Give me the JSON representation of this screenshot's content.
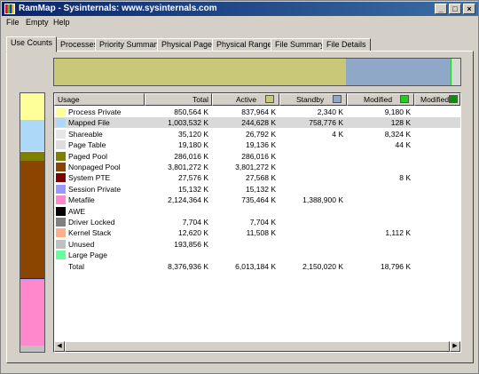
{
  "window": {
    "title": "RamMap - Sysinternals: www.sysinternals.com"
  },
  "window_buttons": {
    "minimize": "_",
    "maximize": "□",
    "close": "×"
  },
  "menu": [
    "File",
    "Empty",
    "Help"
  ],
  "tabs": [
    "Use Counts",
    "Processes",
    "Priority Summary",
    "Physical Pages",
    "Physical Ranges",
    "File Summary",
    "File Details"
  ],
  "active_tab": "Use Counts",
  "colors": {
    "process_private": "#ffff99",
    "mapped_file": "#add8f8",
    "shareable": "#e6e6e6",
    "page_table": "#dddddd",
    "paged_pool": "#808000",
    "nonpaged_pool": "#8b4500",
    "system_pte": "#800000",
    "session_private": "#9999ff",
    "metafile": "#ff88cc",
    "awe": "#000000",
    "driver_locked": "#808080",
    "kernel_stack": "#ffb08a",
    "unused": "#c0c0c0",
    "large_page": "#66ff99",
    "active": "#c8c878",
    "standby": "#8fa8c8",
    "modified": "#22cc22",
    "modified_nw": "#118811"
  },
  "table": {
    "columns": [
      "Usage",
      "Total",
      "Active",
      "Standby",
      "Modified",
      "Modified ..."
    ],
    "rows": [
      {
        "usage": "Process Private",
        "color": "#ffff99",
        "total": "850,564 K",
        "active": "837,964 K",
        "standby": "2,340 K",
        "modified": "9,180 K"
      },
      {
        "usage": "Mapped File",
        "color": "#add8f8",
        "total": "1,003,532 K",
        "active": "244,628 K",
        "standby": "758,776 K",
        "modified": "128 K",
        "selected": true
      },
      {
        "usage": "Shareable",
        "color": "#e6e6e6",
        "total": "35,120 K",
        "active": "26,792 K",
        "standby": "4 K",
        "modified": "8,324 K"
      },
      {
        "usage": "Page Table",
        "color": "#dddddd",
        "total": "19,180 K",
        "active": "19,136 K",
        "standby": "",
        "modified": "44 K"
      },
      {
        "usage": "Paged Pool",
        "color": "#808000",
        "total": "286,016 K",
        "active": "286,016 K",
        "standby": "",
        "modified": ""
      },
      {
        "usage": "Nonpaged Pool",
        "color": "#8b4500",
        "total": "3,801,272 K",
        "active": "3,801,272 K",
        "standby": "",
        "modified": ""
      },
      {
        "usage": "System PTE",
        "color": "#800000",
        "total": "27,576 K",
        "active": "27,568 K",
        "standby": "",
        "modified": "8 K"
      },
      {
        "usage": "Session Private",
        "color": "#9999ff",
        "total": "15,132 K",
        "active": "15,132 K",
        "standby": "",
        "modified": ""
      },
      {
        "usage": "Metafile",
        "color": "#ff88cc",
        "total": "2,124,364 K",
        "active": "735,464 K",
        "standby": "1,388,900 K",
        "modified": ""
      },
      {
        "usage": "AWE",
        "color": "#000000",
        "total": "",
        "active": "",
        "standby": "",
        "modified": ""
      },
      {
        "usage": "Driver Locked",
        "color": "#808080",
        "total": "7,704 K",
        "active": "7,704 K",
        "standby": "",
        "modified": ""
      },
      {
        "usage": "Kernel Stack",
        "color": "#ffb08a",
        "total": "12,620 K",
        "active": "11,508 K",
        "standby": "",
        "modified": "1,112 K"
      },
      {
        "usage": "Unused",
        "color": "#c0c0c0",
        "total": "193,856 K",
        "active": "",
        "standby": "",
        "modified": ""
      },
      {
        "usage": "Large Page",
        "color": "#66ff99",
        "total": "",
        "active": "",
        "standby": "",
        "modified": ""
      },
      {
        "usage": "Total",
        "color": "",
        "total": "8,376,936 K",
        "active": "6,013,184 K",
        "standby": "2,150,020 K",
        "modified": "18,796 K"
      }
    ]
  },
  "top_bar": [
    {
      "name": "active",
      "fraction": 0.718,
      "color": "#c8c878"
    },
    {
      "name": "standby",
      "fraction": 0.257,
      "color": "#8fa8c8"
    },
    {
      "name": "modified",
      "fraction": 0.004,
      "color": "#22cc22"
    },
    {
      "name": "unused",
      "fraction": 0.021,
      "color": "#d8d8d8"
    }
  ],
  "side_bar": [
    {
      "name": "process-private",
      "fraction": 0.102,
      "color": "#ffff99"
    },
    {
      "name": "mapped-file",
      "fraction": 0.12,
      "color": "#add8f8"
    },
    {
      "name": "shareable",
      "fraction": 0.004,
      "color": "#e6e6e6"
    },
    {
      "name": "page-table",
      "fraction": 0.002,
      "color": "#dddddd"
    },
    {
      "name": "paged-pool",
      "fraction": 0.034,
      "color": "#808000"
    },
    {
      "name": "nonpaged-pool",
      "fraction": 0.454,
      "color": "#8b4500"
    },
    {
      "name": "system-pte",
      "fraction": 0.003,
      "color": "#800000"
    },
    {
      "name": "session-private",
      "fraction": 0.002,
      "color": "#9999ff"
    },
    {
      "name": "metafile",
      "fraction": 0.254,
      "color": "#ff88cc"
    },
    {
      "name": "kernel-stack",
      "fraction": 0.002,
      "color": "#ffb08a"
    },
    {
      "name": "unused",
      "fraction": 0.023,
      "color": "#c0c0c0"
    }
  ]
}
